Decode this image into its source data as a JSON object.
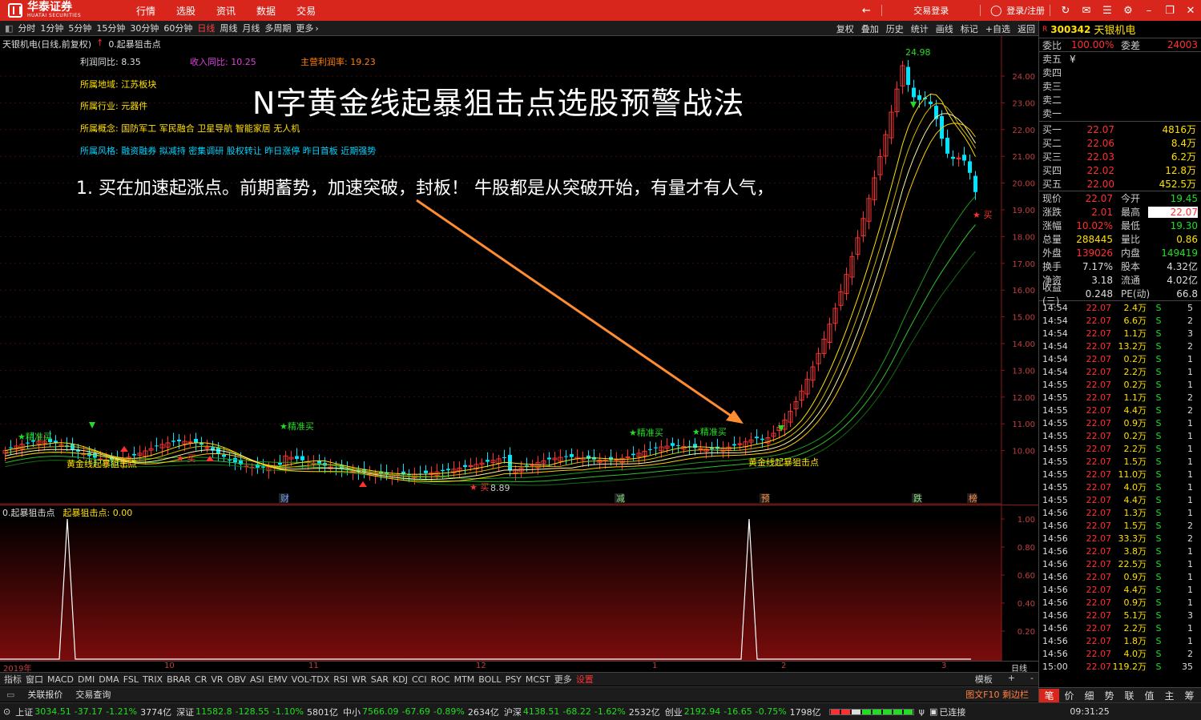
{
  "titlebar": {
    "brand": "华泰证券",
    "brand_sub": "HUATAI SECURITIES",
    "menu": [
      "行情",
      "选股",
      "资讯",
      "数据",
      "交易"
    ],
    "trade_login": "交易登录",
    "user_login": "登录/注册"
  },
  "periods": [
    "分时",
    "1分钟",
    "5分钟",
    "15分钟",
    "30分钟",
    "60分钟",
    "日线",
    "周线",
    "月线",
    "多周期",
    "更多"
  ],
  "active_period": "日线",
  "right_tools": [
    "复权",
    "叠加",
    "历史",
    "统计",
    "画线",
    "标记",
    "+自选",
    "返回"
  ],
  "chart": {
    "header_stock": "天银机电(日线,前复权)",
    "header_indicator": "0.起暴狙击点",
    "info": [
      {
        "label": "利润同比:",
        "value": "8.35"
      },
      {
        "label": "收入同比:",
        "value": "10.25"
      },
      {
        "label": "主营利润率:",
        "value": "19.23"
      },
      {
        "label": "所属地域:",
        "value": "江苏板块"
      },
      {
        "label": "所属行业:",
        "value": "元器件"
      },
      {
        "label": "所属概念:",
        "value": "国防军工 军民融合 卫星导航 智能家居 无人机"
      },
      {
        "label": "所属风格:",
        "value": "融资融券 拟减持 密集调研 股权转让 昨日涨停 昨日首板 近期强势"
      }
    ],
    "title": "N字黄金线起暴狙击点选股预警战法",
    "subtitle": "1. 买在加速起涨点。前期蓄势，加速突破，封板！ 牛股都是从突破开始，有量才有人气，",
    "y_ticks": [
      "24.00",
      "23.00",
      "22.00",
      "21.00",
      "20.00",
      "19.00",
      "18.00",
      "17.00",
      "16.00",
      "15.00",
      "14.00",
      "13.00",
      "12.00",
      "11.00",
      "10.00"
    ],
    "labels": {
      "jingzhunmai": "精准买",
      "golden": "黄金线起暴狙击点",
      "mai": "买",
      "low_price": "8.89",
      "high_label": "24.98",
      "markers": [
        "财",
        "减",
        "预",
        "跌",
        "榜"
      ]
    },
    "colors": {
      "up": "#ff3030",
      "down": "#00e5ff",
      "yellow": "#ffe000",
      "green": "#22aa22"
    }
  },
  "subchart": {
    "name": "0.起暴狙击点",
    "value_label": "起暴狙击点: 0.00",
    "y_ticks": [
      "1.00",
      "0.80",
      "0.60",
      "0.40",
      "0.20"
    ]
  },
  "date_axis": [
    "2019年",
    "10",
    "11",
    "12",
    "1",
    "2",
    "3"
  ],
  "date_axis_right": "日线",
  "indicators": [
    "指标",
    "窗口",
    "MACD",
    "DMI",
    "DMA",
    "FSL",
    "TRIX",
    "BRAR",
    "CR",
    "VR",
    "OBV",
    "ASI",
    "EMV",
    "VOL-TDX",
    "RSI",
    "WR",
    "SAR",
    "KDJ",
    "CCI",
    "ROC",
    "MTM",
    "BOLL",
    "PSY",
    "MCST",
    "更多",
    "设置"
  ],
  "indicators_right": [
    "模板",
    "+",
    "-"
  ],
  "relbar": {
    "tabs": [
      "关联报价",
      "交易查询"
    ],
    "right": "图文F10  剩边栏"
  },
  "status": [
    {
      "name": "上证",
      "price": "3034.51",
      "chg": "-37.17",
      "pct": "-1.21%",
      "amt": "3774亿"
    },
    {
      "name": "深证",
      "price": "11582.8",
      "chg": "-128.55",
      "pct": "-1.10%",
      "amt": "5801亿"
    },
    {
      "name": "中小",
      "price": "7566.09",
      "chg": "-67.69",
      "pct": "-0.89%",
      "amt": "2634亿"
    },
    {
      "name": "沪深",
      "price": "4138.51",
      "chg": "-68.22",
      "pct": "-1.62%",
      "amt": "2532亿"
    },
    {
      "name": "创业",
      "price": "2192.94",
      "chg": "-16.65",
      "pct": "-0.75%",
      "amt": "1798亿"
    }
  ],
  "status_right": {
    "conn": "已连接",
    "time": "09:31:25"
  },
  "quote": {
    "mark": "R",
    "code": "300342",
    "name": "天银机电",
    "weibi_label": "委比",
    "weibi": "100.00%",
    "weicha_label": "委差",
    "weicha": "24003",
    "sells": [
      {
        "label": "卖五",
        "price": "¥",
        "vol": ""
      },
      {
        "label": "卖四",
        "price": "",
        "vol": ""
      },
      {
        "label": "卖三",
        "price": "",
        "vol": ""
      },
      {
        "label": "卖二",
        "price": "",
        "vol": ""
      },
      {
        "label": "卖一",
        "price": "",
        "vol": ""
      }
    ],
    "buys": [
      {
        "label": "买一",
        "price": "22.07",
        "vol": "4816万"
      },
      {
        "label": "买二",
        "price": "22.06",
        "vol": "8.4万"
      },
      {
        "label": "买三",
        "price": "22.03",
        "vol": "6.2万"
      },
      {
        "label": "买四",
        "price": "22.02",
        "vol": "12.8万"
      },
      {
        "label": "买五",
        "price": "22.00",
        "vol": "452.5万"
      }
    ],
    "stats": [
      {
        "l1": "现价",
        "v1": "22.07",
        "c1": "r",
        "l2": "今开",
        "v2": "19.45",
        "c2": "g"
      },
      {
        "l1": "涨跌",
        "v1": "2.01",
        "c1": "r",
        "l2": "最高",
        "v2": "22.07",
        "c2": "r"
      },
      {
        "l1": "涨幅",
        "v1": "10.02%",
        "c1": "r",
        "l2": "最低",
        "v2": "19.30",
        "c2": "g"
      },
      {
        "l1": "总量",
        "v1": "288445",
        "c1": "y",
        "l2": "量比",
        "v2": "0.86",
        "c2": "y"
      },
      {
        "l1": "外盘",
        "v1": "139026",
        "c1": "r",
        "l2": "内盘",
        "v2": "149419",
        "c2": "g"
      },
      {
        "l1": "换手",
        "v1": "7.17%",
        "c1": "w",
        "l2": "股本",
        "v2": "4.32亿",
        "c2": "w"
      },
      {
        "l1": "净资",
        "v1": "3.18",
        "c1": "w",
        "l2": "流通",
        "v2": "4.02亿",
        "c2": "w"
      },
      {
        "l1": "收益(三)",
        "v1": "0.248",
        "c1": "w",
        "l2": "PE(动)",
        "v2": "66.8",
        "c2": "w"
      }
    ],
    "ticks": [
      {
        "t": "14:54",
        "p": "22.07",
        "v": "2.4万",
        "bs": "S",
        "n": "5"
      },
      {
        "t": "14:54",
        "p": "22.07",
        "v": "6.6万",
        "bs": "S",
        "n": "2"
      },
      {
        "t": "14:54",
        "p": "22.07",
        "v": "1.1万",
        "bs": "S",
        "n": "3"
      },
      {
        "t": "14:54",
        "p": "22.07",
        "v": "13.2万",
        "bs": "S",
        "n": "2"
      },
      {
        "t": "14:54",
        "p": "22.07",
        "v": "0.2万",
        "bs": "S",
        "n": "1"
      },
      {
        "t": "14:54",
        "p": "22.07",
        "v": "2.2万",
        "bs": "S",
        "n": "1"
      },
      {
        "t": "14:55",
        "p": "22.07",
        "v": "0.2万",
        "bs": "S",
        "n": "1"
      },
      {
        "t": "14:55",
        "p": "22.07",
        "v": "1.1万",
        "bs": "S",
        "n": "2"
      },
      {
        "t": "14:55",
        "p": "22.07",
        "v": "4.4万",
        "bs": "S",
        "n": "2"
      },
      {
        "t": "14:55",
        "p": "22.07",
        "v": "0.9万",
        "bs": "S",
        "n": "1"
      },
      {
        "t": "14:55",
        "p": "22.07",
        "v": "0.2万",
        "bs": "S",
        "n": "1"
      },
      {
        "t": "14:55",
        "p": "22.07",
        "v": "2.2万",
        "bs": "S",
        "n": "1"
      },
      {
        "t": "14:55",
        "p": "22.07",
        "v": "1.5万",
        "bs": "S",
        "n": "1"
      },
      {
        "t": "14:55",
        "p": "22.07",
        "v": "11.0万",
        "bs": "S",
        "n": "1"
      },
      {
        "t": "14:55",
        "p": "22.07",
        "v": "4.0万",
        "bs": "S",
        "n": "1"
      },
      {
        "t": "14:55",
        "p": "22.07",
        "v": "4.4万",
        "bs": "S",
        "n": "1"
      },
      {
        "t": "14:56",
        "p": "22.07",
        "v": "1.3万",
        "bs": "S",
        "n": "1"
      },
      {
        "t": "14:56",
        "p": "22.07",
        "v": "1.5万",
        "bs": "S",
        "n": "2"
      },
      {
        "t": "14:56",
        "p": "22.07",
        "v": "33.3万",
        "bs": "S",
        "n": "2"
      },
      {
        "t": "14:56",
        "p": "22.07",
        "v": "3.8万",
        "bs": "S",
        "n": "1"
      },
      {
        "t": "14:56",
        "p": "22.07",
        "v": "22.5万",
        "bs": "S",
        "n": "1"
      },
      {
        "t": "14:56",
        "p": "22.07",
        "v": "0.9万",
        "bs": "S",
        "n": "1"
      },
      {
        "t": "14:56",
        "p": "22.07",
        "v": "4.4万",
        "bs": "S",
        "n": "1"
      },
      {
        "t": "14:56",
        "p": "22.07",
        "v": "0.9万",
        "bs": "S",
        "n": "1"
      },
      {
        "t": "14:56",
        "p": "22.07",
        "v": "5.1万",
        "bs": "S",
        "n": "3"
      },
      {
        "t": "14:56",
        "p": "22.07",
        "v": "2.2万",
        "bs": "S",
        "n": "1"
      },
      {
        "t": "14:56",
        "p": "22.07",
        "v": "1.8万",
        "bs": "S",
        "n": "1"
      },
      {
        "t": "14:56",
        "p": "22.07",
        "v": "4.0万",
        "bs": "S",
        "n": "2"
      },
      {
        "t": "15:00",
        "p": "22.07",
        "v": "119.2万",
        "bs": "S",
        "n": "35"
      }
    ],
    "bottom_tabs": [
      "笔",
      "价",
      "细",
      "势",
      "联",
      "值",
      "主",
      "筹"
    ]
  }
}
